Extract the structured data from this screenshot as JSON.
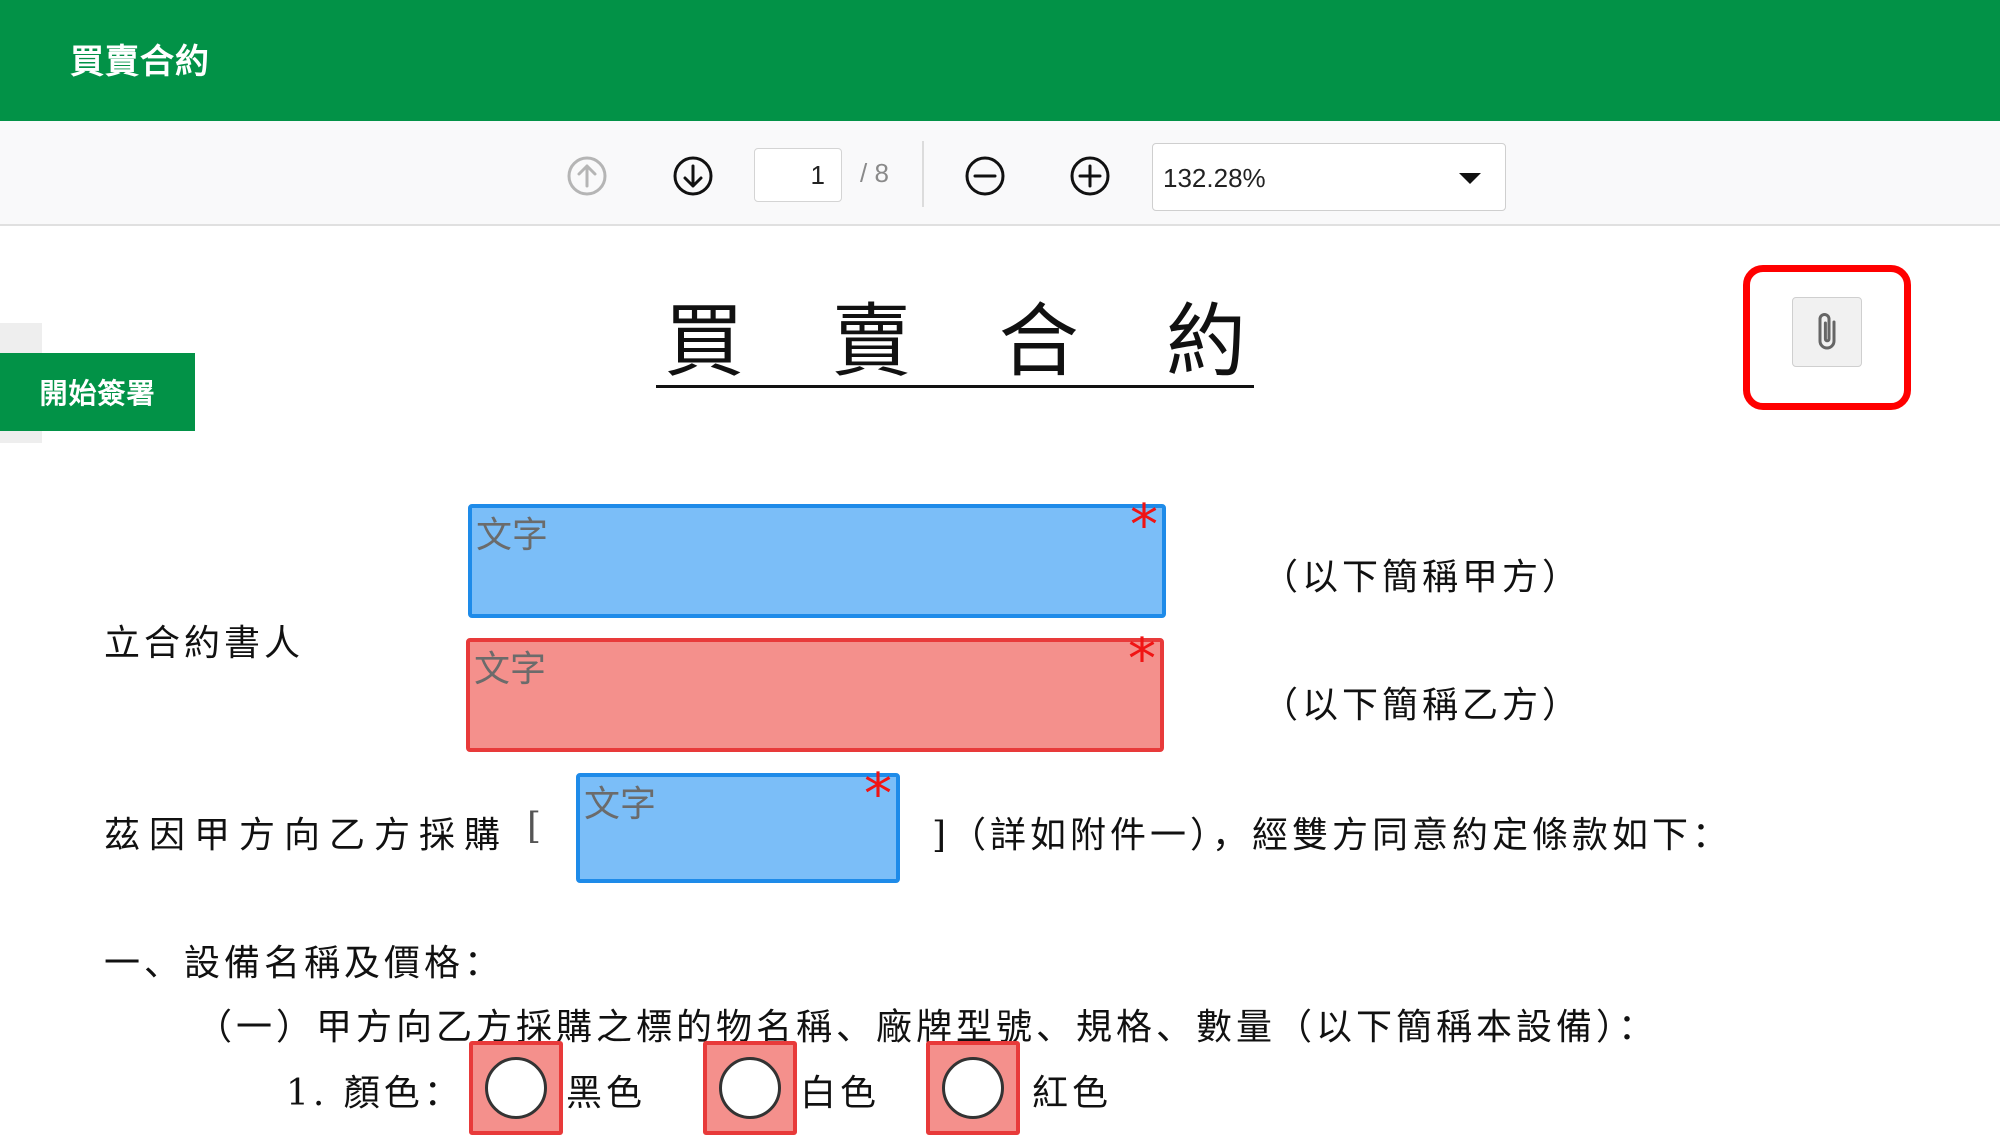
{
  "app": {
    "title": "買賣合約"
  },
  "toolbar": {
    "page_current": "1",
    "page_total": "/ 8",
    "zoom": "132.28%"
  },
  "sidebar": {
    "start_sign_label": "開始簽署"
  },
  "document": {
    "title_chars": [
      "買",
      "賣",
      "合",
      "約"
    ],
    "party_label": "立合約書人",
    "party_a_suffix": "（以下簡稱甲方）",
    "party_b_suffix": "（以下簡稱乙方）",
    "purchase_prefix": "茲因甲方向乙方採購",
    "bracket_open": "[",
    "purchase_suffix": "]（詳如附件一），經雙方同意約定條款如下：",
    "section1_title": "一、設備名稱及價格：",
    "section1_sub": "（一）甲方向乙方採購之標的物名稱、廠牌型號、規格、數量（以下簡稱本設備）：",
    "item1_label": "1.  顏色：",
    "colors": [
      "黑色",
      "白色",
      "紅色"
    ]
  },
  "fields": {
    "placeholder": "文字",
    "required_mark": "*"
  },
  "colors": {
    "header_green": "#029247",
    "field_blue": "#7bbef8",
    "field_red": "#f4908c",
    "highlight_red": "#ff0000"
  },
  "icons": [
    "arrow-up-circle-icon",
    "arrow-down-circle-icon",
    "zoom-out-icon",
    "zoom-in-icon",
    "chevron-down-icon",
    "paperclip-icon"
  ]
}
